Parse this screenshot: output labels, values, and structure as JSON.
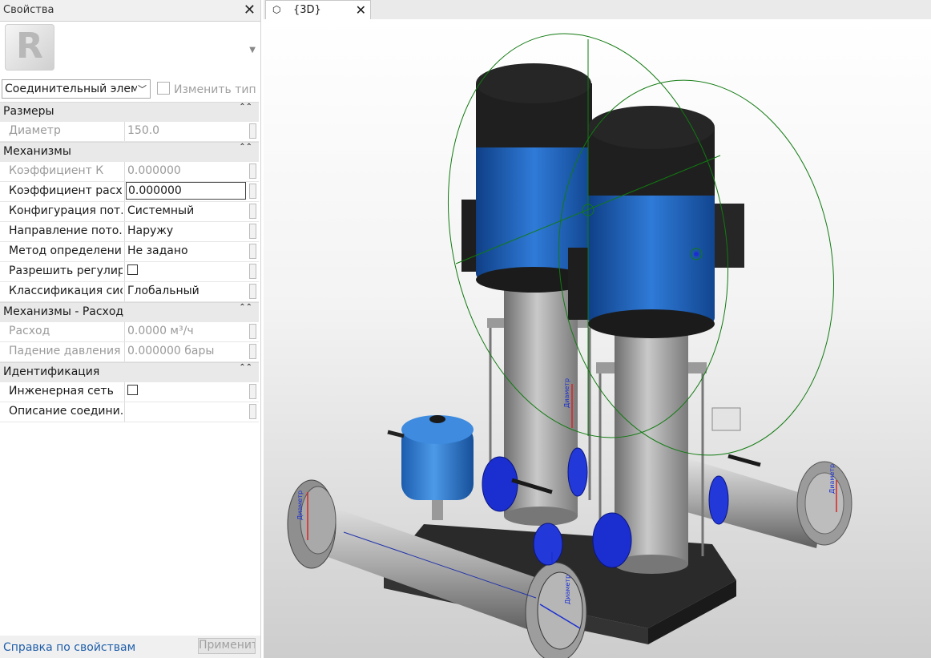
{
  "panel": {
    "title": "Свойства",
    "type_selector": "Соединительный элеме",
    "edit_type_label": "Изменить тип",
    "groups": [
      {
        "label": "Размеры",
        "rows": [
          {
            "name": "Диаметр",
            "value": "150.0",
            "dim": true
          }
        ]
      },
      {
        "label": "Механизмы",
        "rows": [
          {
            "name": "Коэффициент К",
            "value": "0.000000",
            "dim": true
          },
          {
            "name": "Коэффициент расх...",
            "value": "0.000000",
            "dim": false
          },
          {
            "name": "Конфигурация пот...",
            "value": "Системный",
            "dim": false
          },
          {
            "name": "Направление пото...",
            "value": "Наружу",
            "dim": false
          },
          {
            "name": "Метод определени...",
            "value": "Не задано",
            "dim": false
          },
          {
            "name": "Разрешить регулир...",
            "value": "",
            "checkbox": true,
            "dim": false
          },
          {
            "name": "Классификация сис...",
            "value": "Глобальный",
            "dim": false
          }
        ]
      },
      {
        "label": "Механизмы - Расход",
        "rows": [
          {
            "name": "Расход",
            "value": "0.0000 м³/ч",
            "dim": true
          },
          {
            "name": "Падение давления",
            "value": "0.000000 бары",
            "dim": true
          }
        ]
      },
      {
        "label": "Идентификация",
        "rows": [
          {
            "name": "Инженерная сеть",
            "value": "",
            "checkbox": true,
            "dim": false
          },
          {
            "name": "Описание соедини...",
            "value": "",
            "dim": false
          }
        ]
      }
    ],
    "help_link": "Справка по свойствам",
    "apply_button": "Применить"
  },
  "view": {
    "tab_label": "{3D}",
    "annotation_label": "Диаметр"
  }
}
